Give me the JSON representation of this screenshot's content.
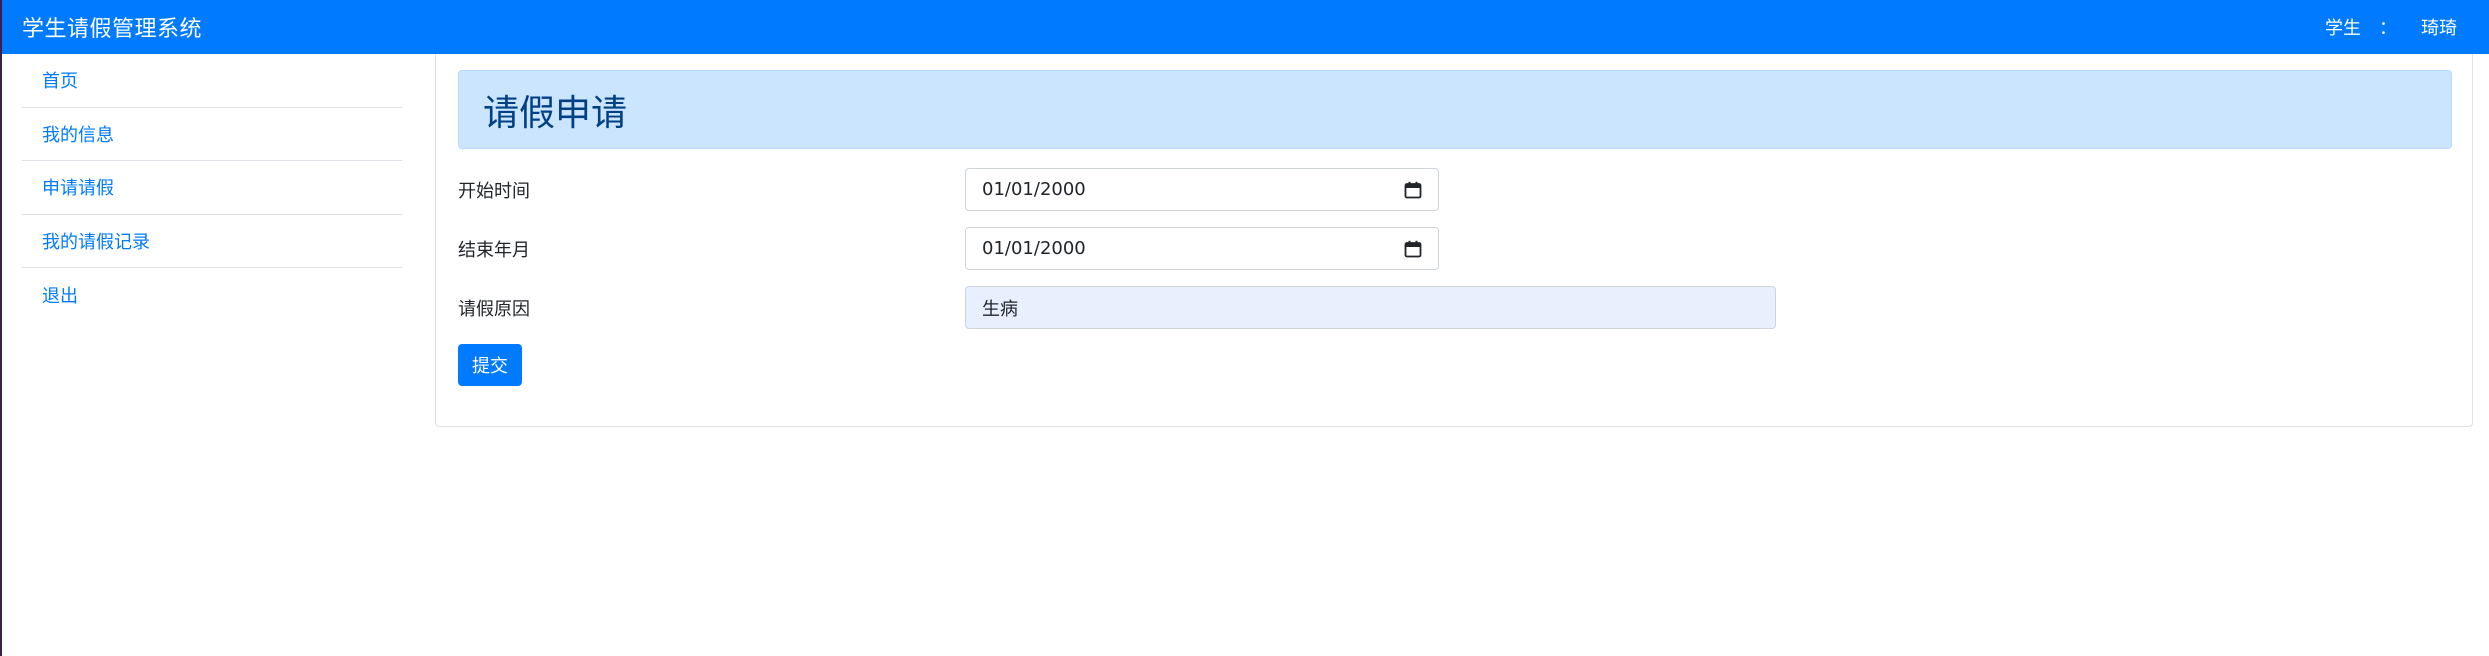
{
  "navbar": {
    "brand": "学生请假管理系统",
    "role": "学生",
    "separator": "：",
    "username": "琦琦"
  },
  "sidebar": {
    "items": [
      {
        "label": "首页"
      },
      {
        "label": "我的信息"
      },
      {
        "label": "申请请假"
      },
      {
        "label": "我的请假记录"
      },
      {
        "label": "退出"
      }
    ]
  },
  "main": {
    "title": "请假申请",
    "fields": {
      "start": {
        "label": "开始时间",
        "value": "01/01/2000",
        "icon": "calendar-icon"
      },
      "end": {
        "label": "结束年月",
        "value": "01/01/2000",
        "icon": "calendar-icon"
      },
      "reason": {
        "label": "请假原因",
        "value": "生病"
      }
    },
    "submit_label": "提交"
  },
  "colors": {
    "primary": "#007bff",
    "alert_bg": "#cce5ff",
    "alert_text": "#004085",
    "autofill_bg": "#e8f0fe"
  }
}
